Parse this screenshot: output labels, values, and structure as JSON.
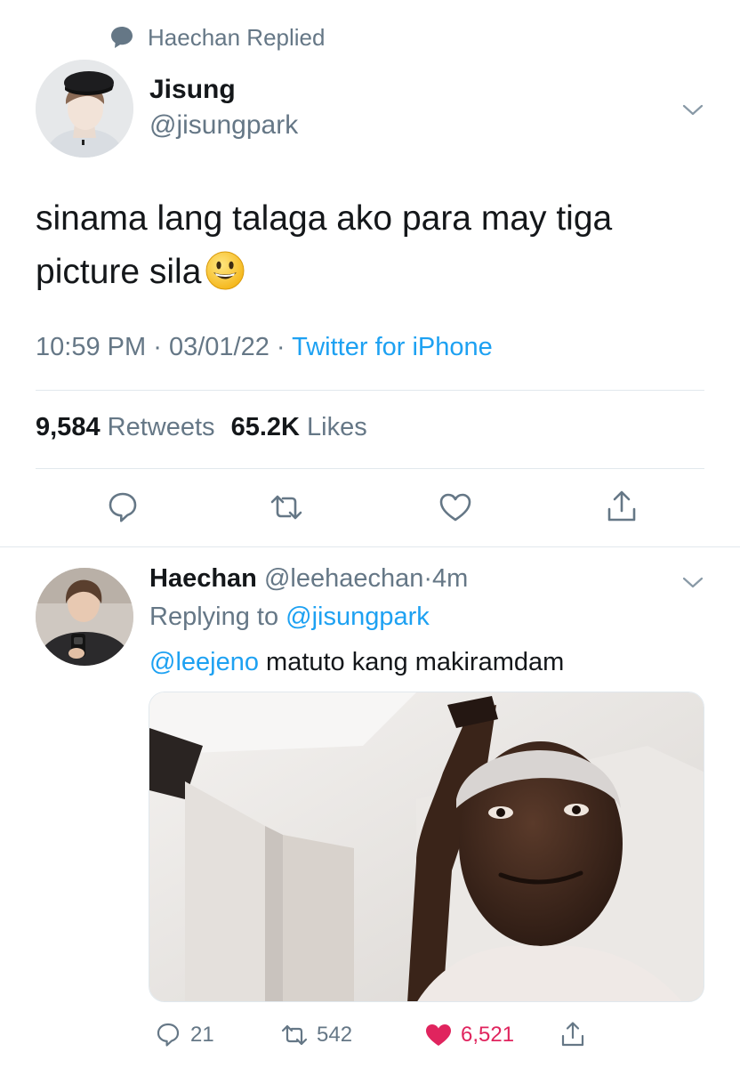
{
  "context": {
    "icon": "speech-bubble-icon",
    "text": "Haechan Replied"
  },
  "main_tweet": {
    "author_name": "Jisung",
    "author_handle": "@jisungpark",
    "text": "sinama lang talaga ako para may tiga picture sila",
    "emoji": "grinning-face-emoji",
    "time": "10:59 PM",
    "date": "03/01/22",
    "separator": "·",
    "source": "Twitter for iPhone",
    "retweets_count": "9,584",
    "retweets_label": "Retweets",
    "likes_count": "65.2K",
    "likes_label": "Likes",
    "actions": [
      "reply-icon",
      "retweet-icon",
      "like-icon",
      "share-icon"
    ]
  },
  "reply_tweet": {
    "author_name": "Haechan",
    "author_handle": "@leehaechan",
    "separator": "·",
    "time_ago": "4m",
    "replying_label": "Replying to",
    "replying_handle": "@jisungpark",
    "mention": "@leejeno",
    "text": "matuto kang makiramdam",
    "reply_count": "21",
    "retweet_count": "542",
    "like_count": "6,521"
  },
  "colors": {
    "accent": "#1da1f2",
    "muted": "#657786",
    "like": "#e0245e",
    "divider": "#e1e8ed"
  }
}
